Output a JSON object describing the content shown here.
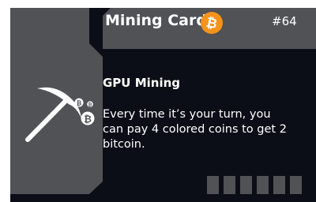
{
  "card": {
    "title": "Mining Card",
    "number": "#64",
    "currency_icon": "bitcoin-icon",
    "art_icon": "pickaxe-icon",
    "ability": {
      "title": "GPU Mining",
      "text": "Every time it’s your turn, you can pay 4 colored coins to get 2 bitcoin."
    }
  },
  "colors": {
    "background": "#0c0e17",
    "panel": "#505256",
    "bitcoin_orange": "#f7931a",
    "text": "#ffffff"
  }
}
